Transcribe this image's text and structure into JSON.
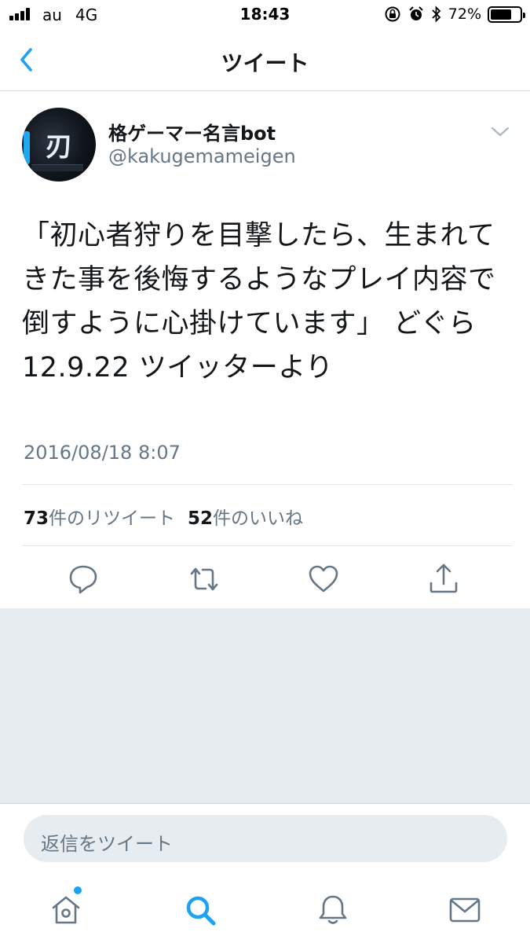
{
  "status_bar": {
    "carrier": "au",
    "network": "4G",
    "time": "18:43",
    "battery_percent": "72%",
    "battery_level": 0.72,
    "icons": [
      "signal-icon",
      "rotation-lock-icon",
      "alarm-icon",
      "bluetooth-icon",
      "battery-icon"
    ]
  },
  "nav": {
    "title": "ツイート",
    "back_icon": "chevron-left-icon"
  },
  "tweet": {
    "display_name": "格ゲーマー名言bot",
    "handle": "@kakugemameigen",
    "text": "「初心者狩りを目撃したら、生まれてきた事を後悔するようなプレイ内容で倒すように心掛けています」 どぐら　12.9.22 ツイッターより",
    "timestamp": "2016/08/18 8:07",
    "retweet_count": "73",
    "retweet_label": "件のリツイート",
    "like_count": "52",
    "like_label": "件のいいね"
  },
  "actions": [
    "reply-icon",
    "retweet-icon",
    "like-icon",
    "share-icon"
  ],
  "reply": {
    "placeholder": "返信をツイート"
  },
  "tab_bar": [
    "home-icon",
    "search-icon",
    "notifications-icon",
    "messages-icon"
  ],
  "colors": {
    "accent": "#1da1f2",
    "muted": "#657786",
    "icon": "#657786",
    "text": "#14171a",
    "background_gray": "#e6ecf0"
  }
}
